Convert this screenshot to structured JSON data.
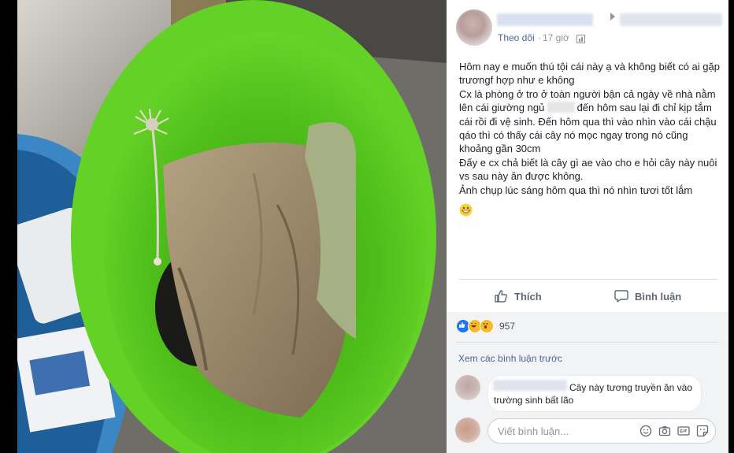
{
  "post": {
    "follow_label": "Theo dõi",
    "separator": "·",
    "time": "17 giờ",
    "text_lines": [
      "Hôm nay e muốn thú tội cái này ạ và không biết có ai gặp trươngf hợp như e không",
      "Cx là phòng ở tro ở toàn người bận cả ngày về nhà nằm lên cái giường ngủ",
      "đến hôm sau lại đi chỉ kịp tắm cái rồi đi vệ sinh. Đến hôm qua thì vào nhìn vào cái chậu qáo thì có thấy cái cây nó mọc ngay trong nó cũng khoảng gần 30cm",
      "Đấy e cx chả biết là cây gì ae vào cho e hỏi cây này nuôi vs sau này ăn được không.",
      "Ảnh chụp lúc sáng hôm qua thì nó nhìn tươi tốt lắm"
    ],
    "emoji": "grinning-face"
  },
  "actions": {
    "like_label": "Thích",
    "comment_label": "Bình luận"
  },
  "reactions": {
    "types": [
      "like",
      "haha",
      "wow"
    ],
    "count": "957"
  },
  "comments": {
    "view_previous_label": "Xem các bình luận trước",
    "items": [
      {
        "text": "Cây này tương truyền ăn vào trường sinh bất lão"
      }
    ],
    "input_placeholder": "Viết bình luận..."
  },
  "colors": {
    "link": "#4b67a1",
    "meta": "#90949c",
    "text": "#1d2129",
    "like_blue": "#1877f2",
    "reaction_yellow": "#f7b928",
    "basin_green": "#5ec922"
  },
  "icons": [
    "thumb-up-icon",
    "comment-icon",
    "globe-icon",
    "emoji-picker-icon",
    "camera-icon",
    "gif-icon",
    "sticker-icon"
  ]
}
